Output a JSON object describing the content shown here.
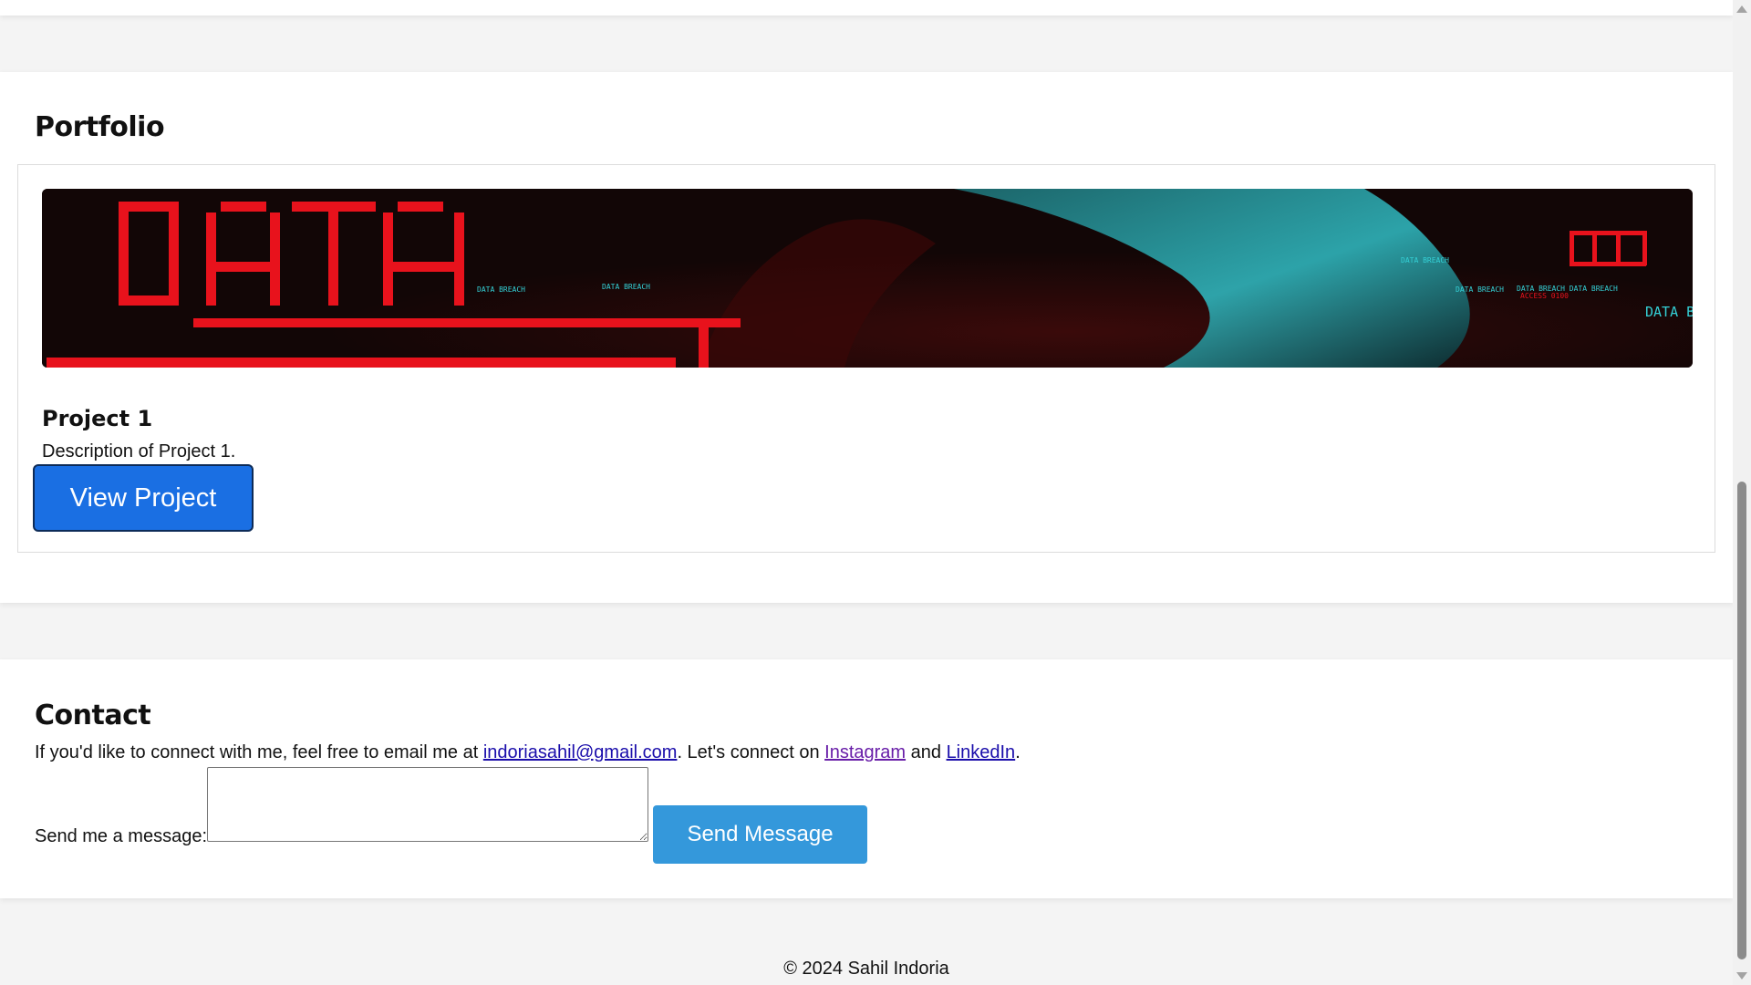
{
  "portfolio": {
    "heading": "Portfolio",
    "project": {
      "image_text": {
        "big_word_1": "DATA",
        "small_labels": [
          "DATA BREACH",
          "DATA BREACH",
          "DATA BREACH",
          "DATA BREACH",
          "DATA BREACH DATA BREACH",
          "ACCESS 0100"
        ],
        "right_word": "DATA",
        "edge_word": "DATA B"
      },
      "title": "Project 1",
      "description": "Description of Project 1.",
      "button_label": "View Project"
    }
  },
  "contact": {
    "heading": "Contact",
    "text_before": "If you'd like to connect with me, feel free to email me at ",
    "email": "indoriasahil@gmail.com",
    "text_middle": ". Let's connect on ",
    "instagram": "Instagram",
    "text_and": " and ",
    "linkedin": "LinkedIn",
    "text_end": ".",
    "message_label": "Send me a message:",
    "message_value": "",
    "send_label": "Send Message"
  },
  "footer": {
    "copyright": "© 2024 Sahil Indoria"
  },
  "colors": {
    "view_button": "#1a6fe3",
    "send_button": "#3498db",
    "link": "#1a0dab",
    "visited_link": "#681da8",
    "image_red": "#e8121c",
    "image_cyan": "#34d0d6"
  }
}
